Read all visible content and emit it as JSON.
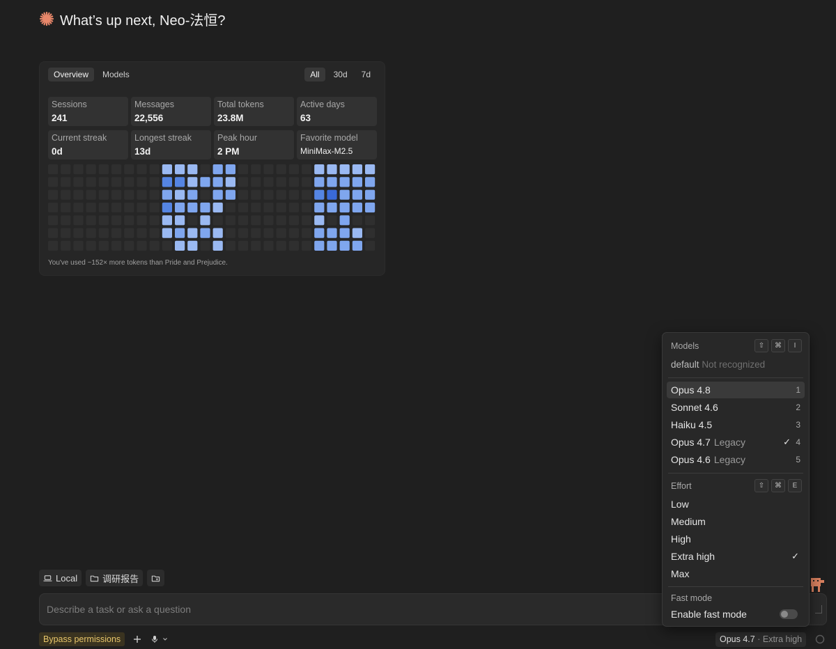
{
  "greeting": {
    "text": "What’s up next, Neo-法恒?",
    "icon": "sparkle-icon",
    "icon_color": "#e8876a"
  },
  "stats": {
    "tabs": [
      {
        "label": "Overview",
        "active": true
      },
      {
        "label": "Models",
        "active": false
      }
    ],
    "ranges": [
      {
        "label": "All",
        "active": true
      },
      {
        "label": "30d",
        "active": false
      },
      {
        "label": "7d",
        "active": false
      }
    ],
    "cards": [
      {
        "label": "Sessions",
        "value": "241"
      },
      {
        "label": "Messages",
        "value": "22,556"
      },
      {
        "label": "Total tokens",
        "value": "23.8M"
      },
      {
        "label": "Active days",
        "value": "63"
      },
      {
        "label": "Current streak",
        "value": "0d"
      },
      {
        "label": "Longest streak",
        "value": "13d"
      },
      {
        "label": "Peak hour",
        "value": "2 PM"
      },
      {
        "label": "Favorite model",
        "value": "MiniMax-M2.5"
      }
    ],
    "caption": "You've used ~152× more tokens than Pride and Prejudice.",
    "heatmap": {
      "rows": 7,
      "cols": 26,
      "colors": {
        "0": "#2f2f2f",
        "1": "#9ab9f2",
        "2": "#7fa6ee",
        "3": "#5585e3",
        "4": "#3a6ad8"
      },
      "levels": [
        "00000000011102200000011111",
        "00000000033122100000022222",
        "00000000021202200000034222",
        "00000000032221000000022222",
        "00000000011010000000010200",
        "00000000012121000000022210",
        "00000000001101000000022220"
      ]
    }
  },
  "attachments": {
    "local_label": "Local",
    "folder_label": "调研报告"
  },
  "composer": {
    "placeholder": "Describe a task or ask a question"
  },
  "bottom": {
    "bypass_label": "Bypass permissions",
    "model_name": "Opus 4.7",
    "effort_suffix": "· Extra high"
  },
  "menu": {
    "models_header": "Models",
    "models_shortcut": [
      "⇧",
      "⌘",
      "I"
    ],
    "default_label": "default",
    "default_status": "Not recognized",
    "models": [
      {
        "name": "Opus 4.8",
        "tag": "",
        "key": "1",
        "checked": false,
        "highlight": true
      },
      {
        "name": "Sonnet 4.6",
        "tag": "",
        "key": "2",
        "checked": false,
        "highlight": false
      },
      {
        "name": "Haiku 4.5",
        "tag": "",
        "key": "3",
        "checked": false,
        "highlight": false
      },
      {
        "name": "Opus 4.7",
        "tag": "Legacy",
        "key": "4",
        "checked": true,
        "highlight": false
      },
      {
        "name": "Opus 4.6",
        "tag": "Legacy",
        "key": "5",
        "checked": false,
        "highlight": false
      }
    ],
    "effort_header": "Effort",
    "effort_shortcut": [
      "⇧",
      "⌘",
      "E"
    ],
    "efforts": [
      {
        "name": "Low",
        "checked": false
      },
      {
        "name": "Medium",
        "checked": false
      },
      {
        "name": "High",
        "checked": false
      },
      {
        "name": "Extra high",
        "checked": true
      },
      {
        "name": "Max",
        "checked": false
      }
    ],
    "fast_header": "Fast mode",
    "fast_label": "Enable fast mode",
    "fast_enabled": false
  }
}
